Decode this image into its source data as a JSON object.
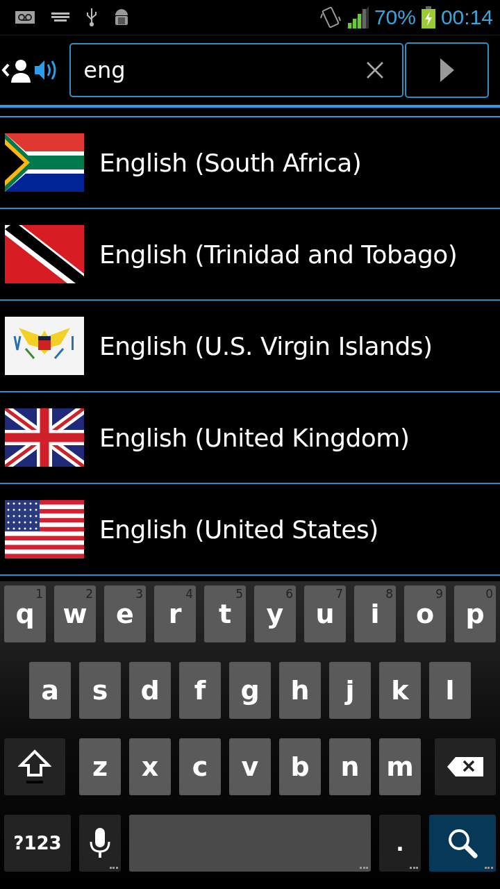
{
  "status_bar": {
    "battery": "70%",
    "time": "00:14"
  },
  "search_field": {
    "value": "eng"
  },
  "languages": [
    {
      "label": "English (South Africa)",
      "kind": "za"
    },
    {
      "label": "English (Trinidad and Tobago)",
      "kind": "tt"
    },
    {
      "label": "English (U.S. Virgin Islands)",
      "kind": "vi"
    },
    {
      "label": "English (United Kingdom)",
      "kind": "gb"
    },
    {
      "label": "English (United States)",
      "kind": "us"
    }
  ],
  "keyboard": {
    "rows": [
      {
        "keys": [
          {
            "kind": "letter",
            "label": "q",
            "hint": "1"
          },
          {
            "kind": "letter",
            "label": "w",
            "hint": "2"
          },
          {
            "kind": "letter",
            "label": "e",
            "hint": "3"
          },
          {
            "kind": "letter",
            "label": "r",
            "hint": "4"
          },
          {
            "kind": "letter",
            "label": "t",
            "hint": "5"
          },
          {
            "kind": "letter",
            "label": "y",
            "hint": "6"
          },
          {
            "kind": "letter",
            "label": "u",
            "hint": "7"
          },
          {
            "kind": "letter",
            "label": "i",
            "hint": "8"
          },
          {
            "kind": "letter",
            "label": "o",
            "hint": "9"
          },
          {
            "kind": "letter",
            "label": "p",
            "hint": "0"
          }
        ]
      },
      {
        "keys": [
          {
            "kind": "letter",
            "label": "a"
          },
          {
            "kind": "letter",
            "label": "s"
          },
          {
            "kind": "letter",
            "label": "d"
          },
          {
            "kind": "letter",
            "label": "f"
          },
          {
            "kind": "letter",
            "label": "g"
          },
          {
            "kind": "letter",
            "label": "h"
          },
          {
            "kind": "letter",
            "label": "j"
          },
          {
            "kind": "letter",
            "label": "k"
          },
          {
            "kind": "letter",
            "label": "l"
          }
        ]
      },
      {
        "keys": [
          {
            "kind": "shift"
          },
          {
            "kind": "letter",
            "label": "z"
          },
          {
            "kind": "letter",
            "label": "x"
          },
          {
            "kind": "letter",
            "label": "c"
          },
          {
            "kind": "letter",
            "label": "v"
          },
          {
            "kind": "letter",
            "label": "b"
          },
          {
            "kind": "letter",
            "label": "n"
          },
          {
            "kind": "letter",
            "label": "m"
          },
          {
            "kind": "delete"
          }
        ]
      },
      {
        "keys": [
          {
            "kind": "symbols",
            "label": "?123"
          },
          {
            "kind": "mic"
          },
          {
            "kind": "space"
          },
          {
            "kind": "period",
            "label": "."
          },
          {
            "kind": "search"
          }
        ]
      }
    ]
  }
}
